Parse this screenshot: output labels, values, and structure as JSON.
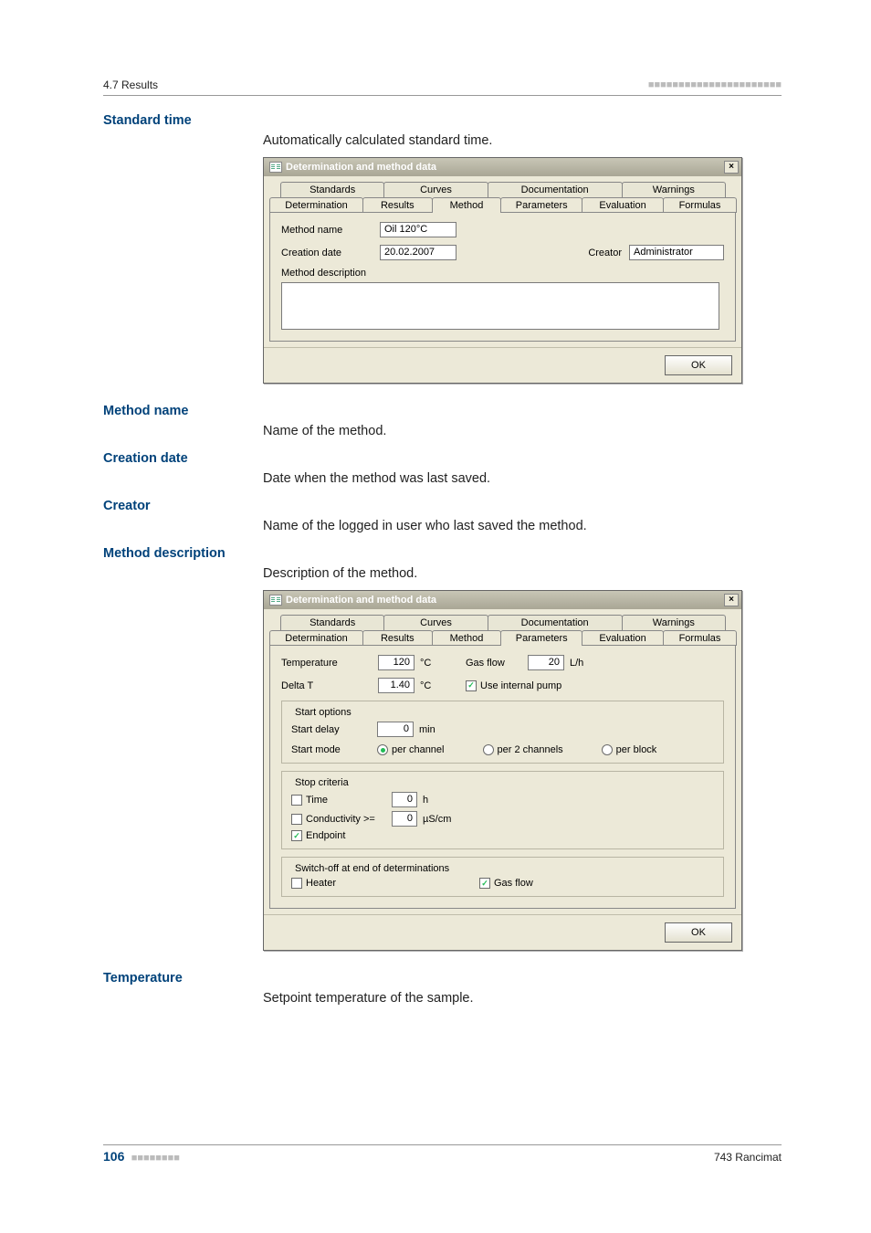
{
  "header": {
    "section": "4.7 Results",
    "trail": "■■■■■■■■■■■■■■■■■■■■■■"
  },
  "footer": {
    "page_number": "106",
    "page_suffix": "■■■■■■■■",
    "product": "743 Rancimat"
  },
  "fields": {
    "standard_time": {
      "label": "Standard time",
      "desc": "Automatically calculated standard time."
    },
    "method_name": {
      "label": "Method name",
      "desc": "Name of the method."
    },
    "creation_date": {
      "label": "Creation date",
      "desc": "Date when the method was last saved."
    },
    "creator": {
      "label": "Creator",
      "desc": "Name of the logged in user who last saved the method."
    },
    "method_description": {
      "label": "Method description",
      "desc": "Description of the method."
    },
    "temperature": {
      "label": "Temperature",
      "desc": "Setpoint temperature of the sample."
    }
  },
  "dialog1": {
    "title": "Determination and method data",
    "close": "×",
    "tabs_row1": [
      "Standards",
      "Curves",
      "Documentation",
      "Warnings"
    ],
    "tabs_row2": [
      "Determination",
      "Results",
      "Method",
      "Parameters",
      "Evaluation",
      "Formulas"
    ],
    "active_tab": "Method",
    "method_name_label": "Method name",
    "method_name_value": "Oil 120°C",
    "creation_date_label": "Creation date",
    "creation_date_value": "20.02.2007",
    "creator_label": "Creator",
    "creator_value": "Administrator",
    "method_description_label": "Method description",
    "method_description_value": "",
    "ok": "OK"
  },
  "dialog2": {
    "title": "Determination and method data",
    "close": "×",
    "tabs_row1": [
      "Standards",
      "Curves",
      "Documentation",
      "Warnings"
    ],
    "tabs_row2": [
      "Determination",
      "Results",
      "Method",
      "Parameters",
      "Evaluation",
      "Formulas"
    ],
    "active_tab": "Parameters",
    "temperature_label": "Temperature",
    "temperature_value": "120",
    "temperature_unit": "°C",
    "gasflow_label": "Gas flow",
    "gasflow_value": "20",
    "gasflow_unit": "L/h",
    "delta_t_label": "Delta T",
    "delta_t_value": "1.40",
    "delta_t_unit": "°C",
    "use_internal_pump_label": "Use internal pump",
    "use_internal_pump_checked": true,
    "start_options_legend": "Start options",
    "start_delay_label": "Start delay",
    "start_delay_value": "0",
    "start_delay_unit": "min",
    "start_mode_label": "Start mode",
    "start_mode_options": {
      "per_channel": "per channel",
      "per_2_channels": "per 2 channels",
      "per_block": "per block"
    },
    "start_mode_selected": "per_channel",
    "stop_criteria_legend": "Stop criteria",
    "stop_time_label": "Time",
    "stop_time_value": "0",
    "stop_time_unit": "h",
    "stop_time_checked": false,
    "stop_cond_label": "Conductivity >=",
    "stop_cond_value": "0",
    "stop_cond_unit": "µS/cm",
    "stop_cond_checked": false,
    "stop_endpoint_label": "Endpoint",
    "stop_endpoint_checked": true,
    "switchoff_legend": "Switch-off at end of determinations",
    "switchoff_heater_label": "Heater",
    "switchoff_heater_checked": false,
    "switchoff_gasflow_label": "Gas flow",
    "switchoff_gasflow_checked": true,
    "ok": "OK"
  }
}
